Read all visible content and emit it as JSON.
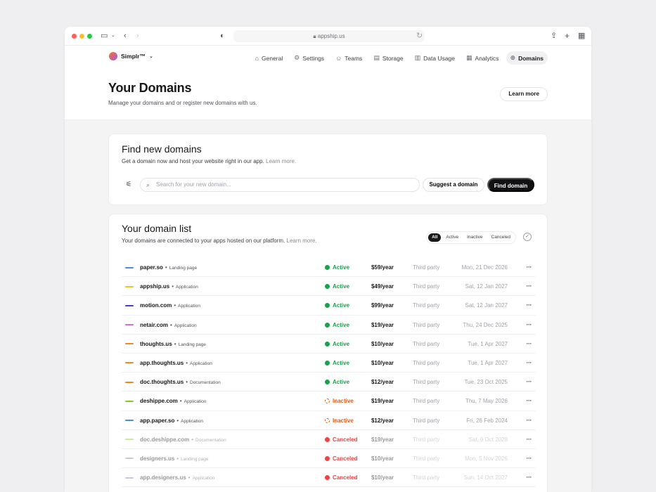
{
  "browser": {
    "url": "appship.us"
  },
  "colors": {
    "traffic": [
      "#ff5f57",
      "#febc2e",
      "#28c840"
    ]
  },
  "brand": {
    "name": "Simplr™"
  },
  "nav": {
    "items": [
      {
        "label": "General",
        "icon": "home-icon",
        "glyph": "⌂"
      },
      {
        "label": "Settings",
        "icon": "gear-icon",
        "glyph": "⚙"
      },
      {
        "label": "Teams",
        "icon": "users-icon",
        "glyph": "☺"
      },
      {
        "label": "Storage",
        "icon": "storage-icon",
        "glyph": "▤"
      },
      {
        "label": "Data Usage",
        "icon": "chart-icon",
        "glyph": "▥"
      },
      {
        "label": "Analytics",
        "icon": "analytics-icon",
        "glyph": "▦"
      },
      {
        "label": "Domains",
        "icon": "globe-icon",
        "glyph": "⊕",
        "active": true
      }
    ]
  },
  "header": {
    "title": "Your Domains",
    "subtitle": "Manage your domains and or register new domains with us.",
    "learn_more": "Learn more"
  },
  "find": {
    "title": "Find new domains",
    "subtitle": "Get a domain now and host your website right in our app.",
    "subtitle_link": "Learn more.",
    "search_placeholder": "Search for your new domain...",
    "suggest_label": "Suggest a domain",
    "find_label": "Find domain"
  },
  "list": {
    "title": "Your domain list",
    "subtitle": "Your domains are connected to your apps hosted on our platform.",
    "subtitle_link": "Learn more.",
    "filters": [
      "All",
      "Active",
      "Inactive",
      "Canceled"
    ],
    "active_filter": "All",
    "rows": [
      {
        "domain": "paper.so",
        "type": "Landing page",
        "color": "#4f86e0",
        "status": "Active",
        "price": "$59/year",
        "party": "Third party",
        "date": "Mon, 21 Dec 2026"
      },
      {
        "domain": "appship.us",
        "type": "Application",
        "color": "#e6c619",
        "status": "Active",
        "price": "$49/year",
        "party": "Third party",
        "date": "Sat, 12 Jan 2027"
      },
      {
        "domain": "motion.com",
        "type": "Application",
        "color": "#3f3fcf",
        "status": "Active",
        "price": "$99/year",
        "party": "Third party",
        "date": "Sat, 12 Jan 2027"
      },
      {
        "domain": "netair.com",
        "type": "Application",
        "color": "#d66bd6",
        "status": "Active",
        "price": "$19/year",
        "party": "Third party",
        "date": "Thu, 24 Dec 2025"
      },
      {
        "domain": "thoughts.us",
        "type": "Landing page",
        "color": "#f08a24",
        "status": "Active",
        "price": "$10/year",
        "party": "Third party",
        "date": "Tue, 1 Apr 2027"
      },
      {
        "domain": "app.thoughts.us",
        "type": "Application",
        "color": "#f08a24",
        "status": "Active",
        "price": "$10/year",
        "party": "Third party",
        "date": "Tue, 1 Apr 2027"
      },
      {
        "domain": "doc.thoughts.us",
        "type": "Documentation",
        "color": "#f08a24",
        "status": "Active",
        "price": "$12/year",
        "party": "Third party",
        "date": "Tue, 23 Oct 2025"
      },
      {
        "domain": "deshippe.com",
        "type": "Application",
        "color": "#84cc2a",
        "status": "Inactive",
        "price": "$19/year",
        "party": "Third party",
        "date": "Thu, 7 May 2026"
      },
      {
        "domain": "app.paper.so",
        "type": "Application",
        "color": "#4f86e0",
        "status": "Inactive",
        "price": "$12/year",
        "party": "Third party",
        "date": "Fri, 26 Feb 2024"
      },
      {
        "domain": "doc.deshippe.com",
        "type": "Documentation",
        "color": "#84cc2a",
        "status": "Canceled",
        "price": "$19/year",
        "party": "Third party",
        "date": "Sat, 9 Oct 2028"
      },
      {
        "domain": "designers.us",
        "type": "Landing page",
        "color": "#8a8ab0",
        "status": "Canceled",
        "price": "$10/year",
        "party": "Third party",
        "date": "Mon, 5 Nov 2026"
      },
      {
        "domain": "app.designers.us",
        "type": "Application",
        "color": "#8a8ab0",
        "status": "Canceled",
        "price": "$10/year",
        "party": "Third party",
        "date": "Sun, 14 Oct 2027"
      }
    ]
  }
}
